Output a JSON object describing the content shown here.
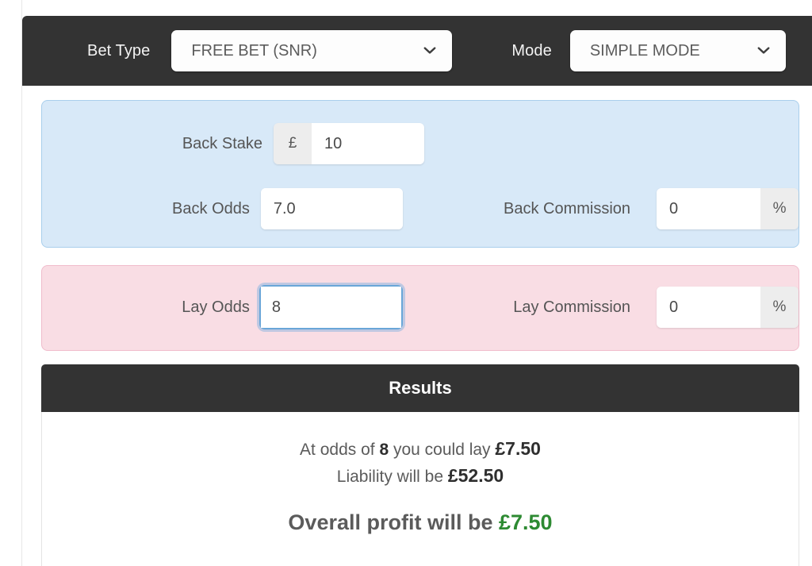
{
  "topbar": {
    "bet_type_label": "Bet Type",
    "bet_type_value": "FREE BET (SNR)",
    "mode_label": "Mode",
    "mode_value": "SIMPLE MODE",
    "chevron_icon": "chevron-down-icon",
    "bg_color": "#333333"
  },
  "back_panel": {
    "bg_color": "#d8e9f8",
    "border_color": "#a9cfec",
    "stake_label": "Back Stake",
    "stake_currency_addon": "£",
    "stake_value": "10",
    "stake_placeholder": "",
    "odds_label": "Back Odds",
    "odds_value": "7.0",
    "odds_placeholder": "",
    "commission_label": "Back Commission",
    "commission_value": "0",
    "commission_percent_addon": "%"
  },
  "lay_panel": {
    "bg_color": "#f9dde4",
    "border_color": "#f0bccc",
    "odds_label": "Lay Odds",
    "odds_value": "8",
    "odds_placeholder": "",
    "odds_focused": true,
    "commission_label": "Lay Commission",
    "commission_value": "0",
    "commission_percent_addon": "%"
  },
  "results": {
    "title": "Results",
    "line1_pre": "At odds of ",
    "line1_odds": "8",
    "line1_mid": " you could lay ",
    "line1_amount": "£7.50",
    "line2_pre": "Liability will be ",
    "line2_amount": "£52.50",
    "overall_label": "Overall profit will be ",
    "overall_amount": "£7.50",
    "profit_color": "#2d8a32"
  }
}
